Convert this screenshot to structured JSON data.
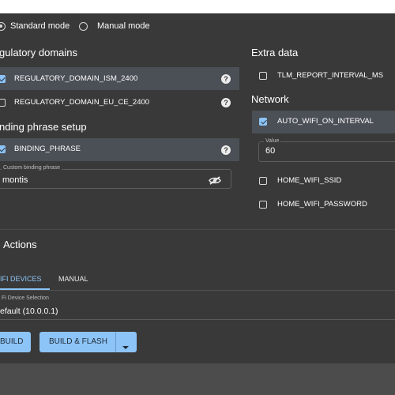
{
  "mode": {
    "standard_label": "Standard mode",
    "manual_label": "Manual mode",
    "selected": "standard"
  },
  "regulatory": {
    "heading": "gulatory domains",
    "items": [
      {
        "label": "REGULATORY_DOMAIN_ISM_2400",
        "checked": true
      },
      {
        "label": "REGULATORY_DOMAIN_EU_CE_2400",
        "checked": false
      }
    ]
  },
  "binding": {
    "heading": "nding phrase setup",
    "option_label": "BINDING_PHRASE",
    "option_checked": true,
    "field_label": "Custom binding phrase",
    "field_value": "montis"
  },
  "extra_data": {
    "heading": "Extra data",
    "items": [
      {
        "label": "TLM_REPORT_INTERVAL_MS",
        "checked": false
      }
    ]
  },
  "network": {
    "heading": "Network",
    "auto_wifi_label": "AUTO_WIFI_ON_INTERVAL",
    "auto_wifi_checked": true,
    "value_label": "Value",
    "value": "60",
    "ssid_label": "HOME_WIFI_SSID",
    "password_label": "HOME_WIFI_PASSWORD"
  },
  "actions": {
    "heading": "Actions",
    "tabs": [
      {
        "label": "IFI DEVICES",
        "active": true
      },
      {
        "label": "MANUAL",
        "active": false
      }
    ],
    "device_selection_label": "Fi Device Selection",
    "device_selection_value": "efault (10.0.0.1)",
    "build_label": "BUILD",
    "build_flash_label": "BUILD & FLASH"
  },
  "icons": {
    "help": "help-circle-icon",
    "visibility_off": "eye-off-icon",
    "dropdown": "chevron-down-icon"
  },
  "colors": {
    "accent": "#8dc4f7",
    "panel": "#393939",
    "highlight_row": "#4b4f56"
  }
}
